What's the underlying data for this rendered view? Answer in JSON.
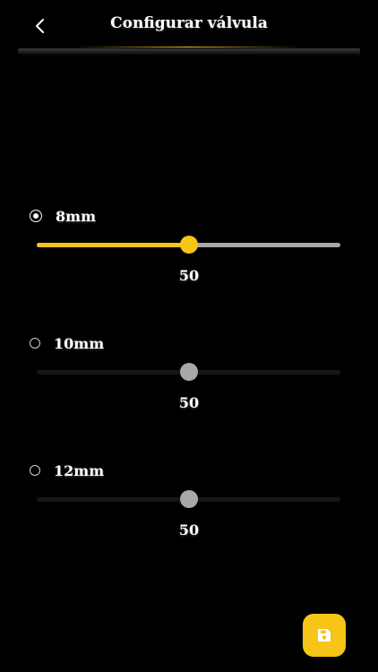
{
  "header": {
    "title": "Configurar válvula",
    "back_icon": "chevron-left-icon"
  },
  "colors": {
    "accent": "#f5c518",
    "background": "#000000",
    "track_inactive": "#a8a8a8"
  },
  "options": [
    {
      "label": "8mm",
      "selected": true,
      "value": "50",
      "fraction": 0.5
    },
    {
      "label": "10mm",
      "selected": false,
      "value": "50",
      "fraction": 0.5
    },
    {
      "label": "12mm",
      "selected": false,
      "value": "50",
      "fraction": 0.5
    }
  ],
  "save": {
    "icon": "floppy-disk-icon"
  }
}
